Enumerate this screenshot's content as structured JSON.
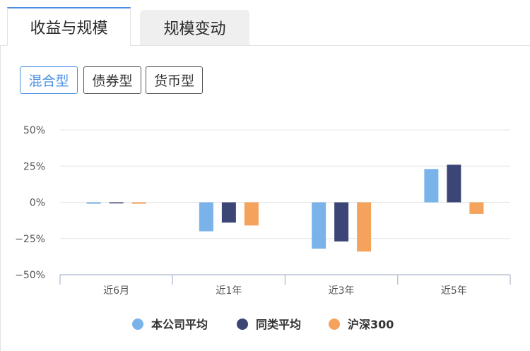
{
  "tabs": [
    {
      "label": "收益与规模"
    },
    {
      "label": "规模变动"
    }
  ],
  "filters": [
    {
      "label": "混合型"
    },
    {
      "label": "债券型"
    },
    {
      "label": "货币型"
    }
  ],
  "chart_data": {
    "type": "bar",
    "categories": [
      "近6月",
      "近1年",
      "近3年",
      "近5年"
    ],
    "series": [
      {
        "name": "本公司平均",
        "color": "#7ab3ea",
        "values": [
          -1,
          -20,
          -32,
          23
        ]
      },
      {
        "name": "同类平均",
        "color": "#3b4676",
        "values": [
          -0.5,
          -14,
          -27,
          26
        ]
      },
      {
        "name": "沪深300",
        "color": "#f5a35c",
        "values": [
          -1,
          -16,
          -34,
          -8
        ]
      }
    ],
    "yticks": [
      50,
      25,
      0,
      -25,
      -50
    ],
    "ytick_labels": [
      "50%",
      "25%",
      "0%",
      "−25%",
      "−50%"
    ],
    "ylim": [
      -50,
      50
    ],
    "grid": true,
    "legend_position": "bottom"
  }
}
